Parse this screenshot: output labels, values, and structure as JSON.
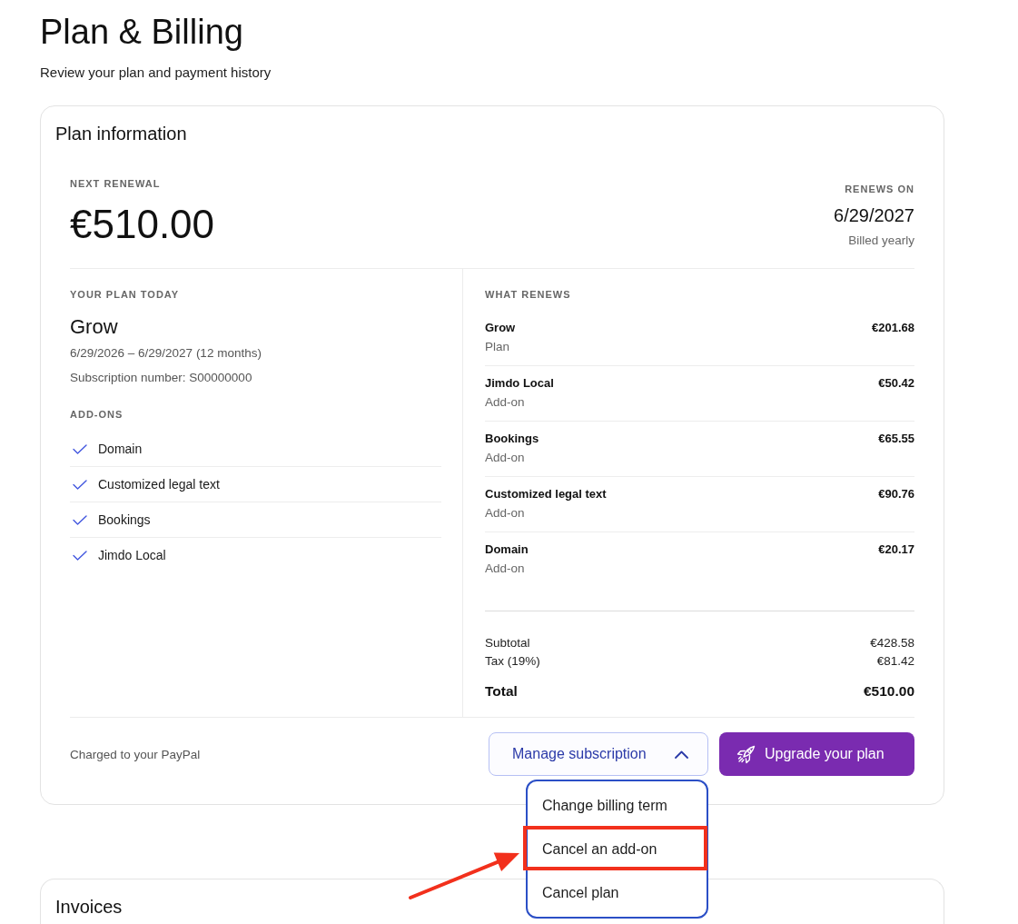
{
  "page": {
    "title": "Plan & Billing",
    "subtitle": "Review your plan and payment history"
  },
  "plan_card": {
    "title": "Plan information",
    "next_renewal": {
      "label": "NEXT RENEWAL",
      "amount": "€510.00"
    },
    "renews_on": {
      "label": "RENEWS ON",
      "date": "6/29/2027",
      "billing": "Billed yearly"
    },
    "plan_today": {
      "label": "YOUR PLAN TODAY",
      "name": "Grow",
      "period": "6/29/2026 – 6/29/2027 (12 months)",
      "subscription_number": "Subscription number: S00000000",
      "addons_label": "ADD-ONS",
      "addons": [
        "Domain",
        "Customized legal text",
        "Bookings",
        "Jimdo Local"
      ]
    },
    "what_renews": {
      "label": "WHAT RENEWS",
      "items": [
        {
          "name": "Grow",
          "description": "Plan",
          "price": "€201.68"
        },
        {
          "name": "Jimdo Local",
          "description": "Add-on",
          "price": "€50.42"
        },
        {
          "name": "Bookings",
          "description": "Add-on",
          "price": "€65.55"
        },
        {
          "name": "Customized legal text",
          "description": "Add-on",
          "price": "€90.76"
        },
        {
          "name": "Domain",
          "description": "Add-on",
          "price": "€20.17"
        }
      ],
      "totals": [
        {
          "kind": "line",
          "label": "Subtotal",
          "value": "€428.58"
        },
        {
          "kind": "line",
          "label": "Tax (19%)",
          "value": "€81.42"
        },
        {
          "kind": "total",
          "label": "Total",
          "value": "€510.00"
        }
      ]
    },
    "payment_note": "Charged to your PayPal",
    "manage_button": {
      "label": "Manage subscription",
      "expanded": true,
      "menu": [
        {
          "label": "Change billing term",
          "highlighted": false
        },
        {
          "label": "Cancel an add-on",
          "highlighted": true
        },
        {
          "label": "Cancel plan",
          "highlighted": false
        }
      ]
    },
    "upgrade_button": {
      "label": "Upgrade your plan"
    }
  },
  "invoices_card": {
    "title": "Invoices"
  }
}
